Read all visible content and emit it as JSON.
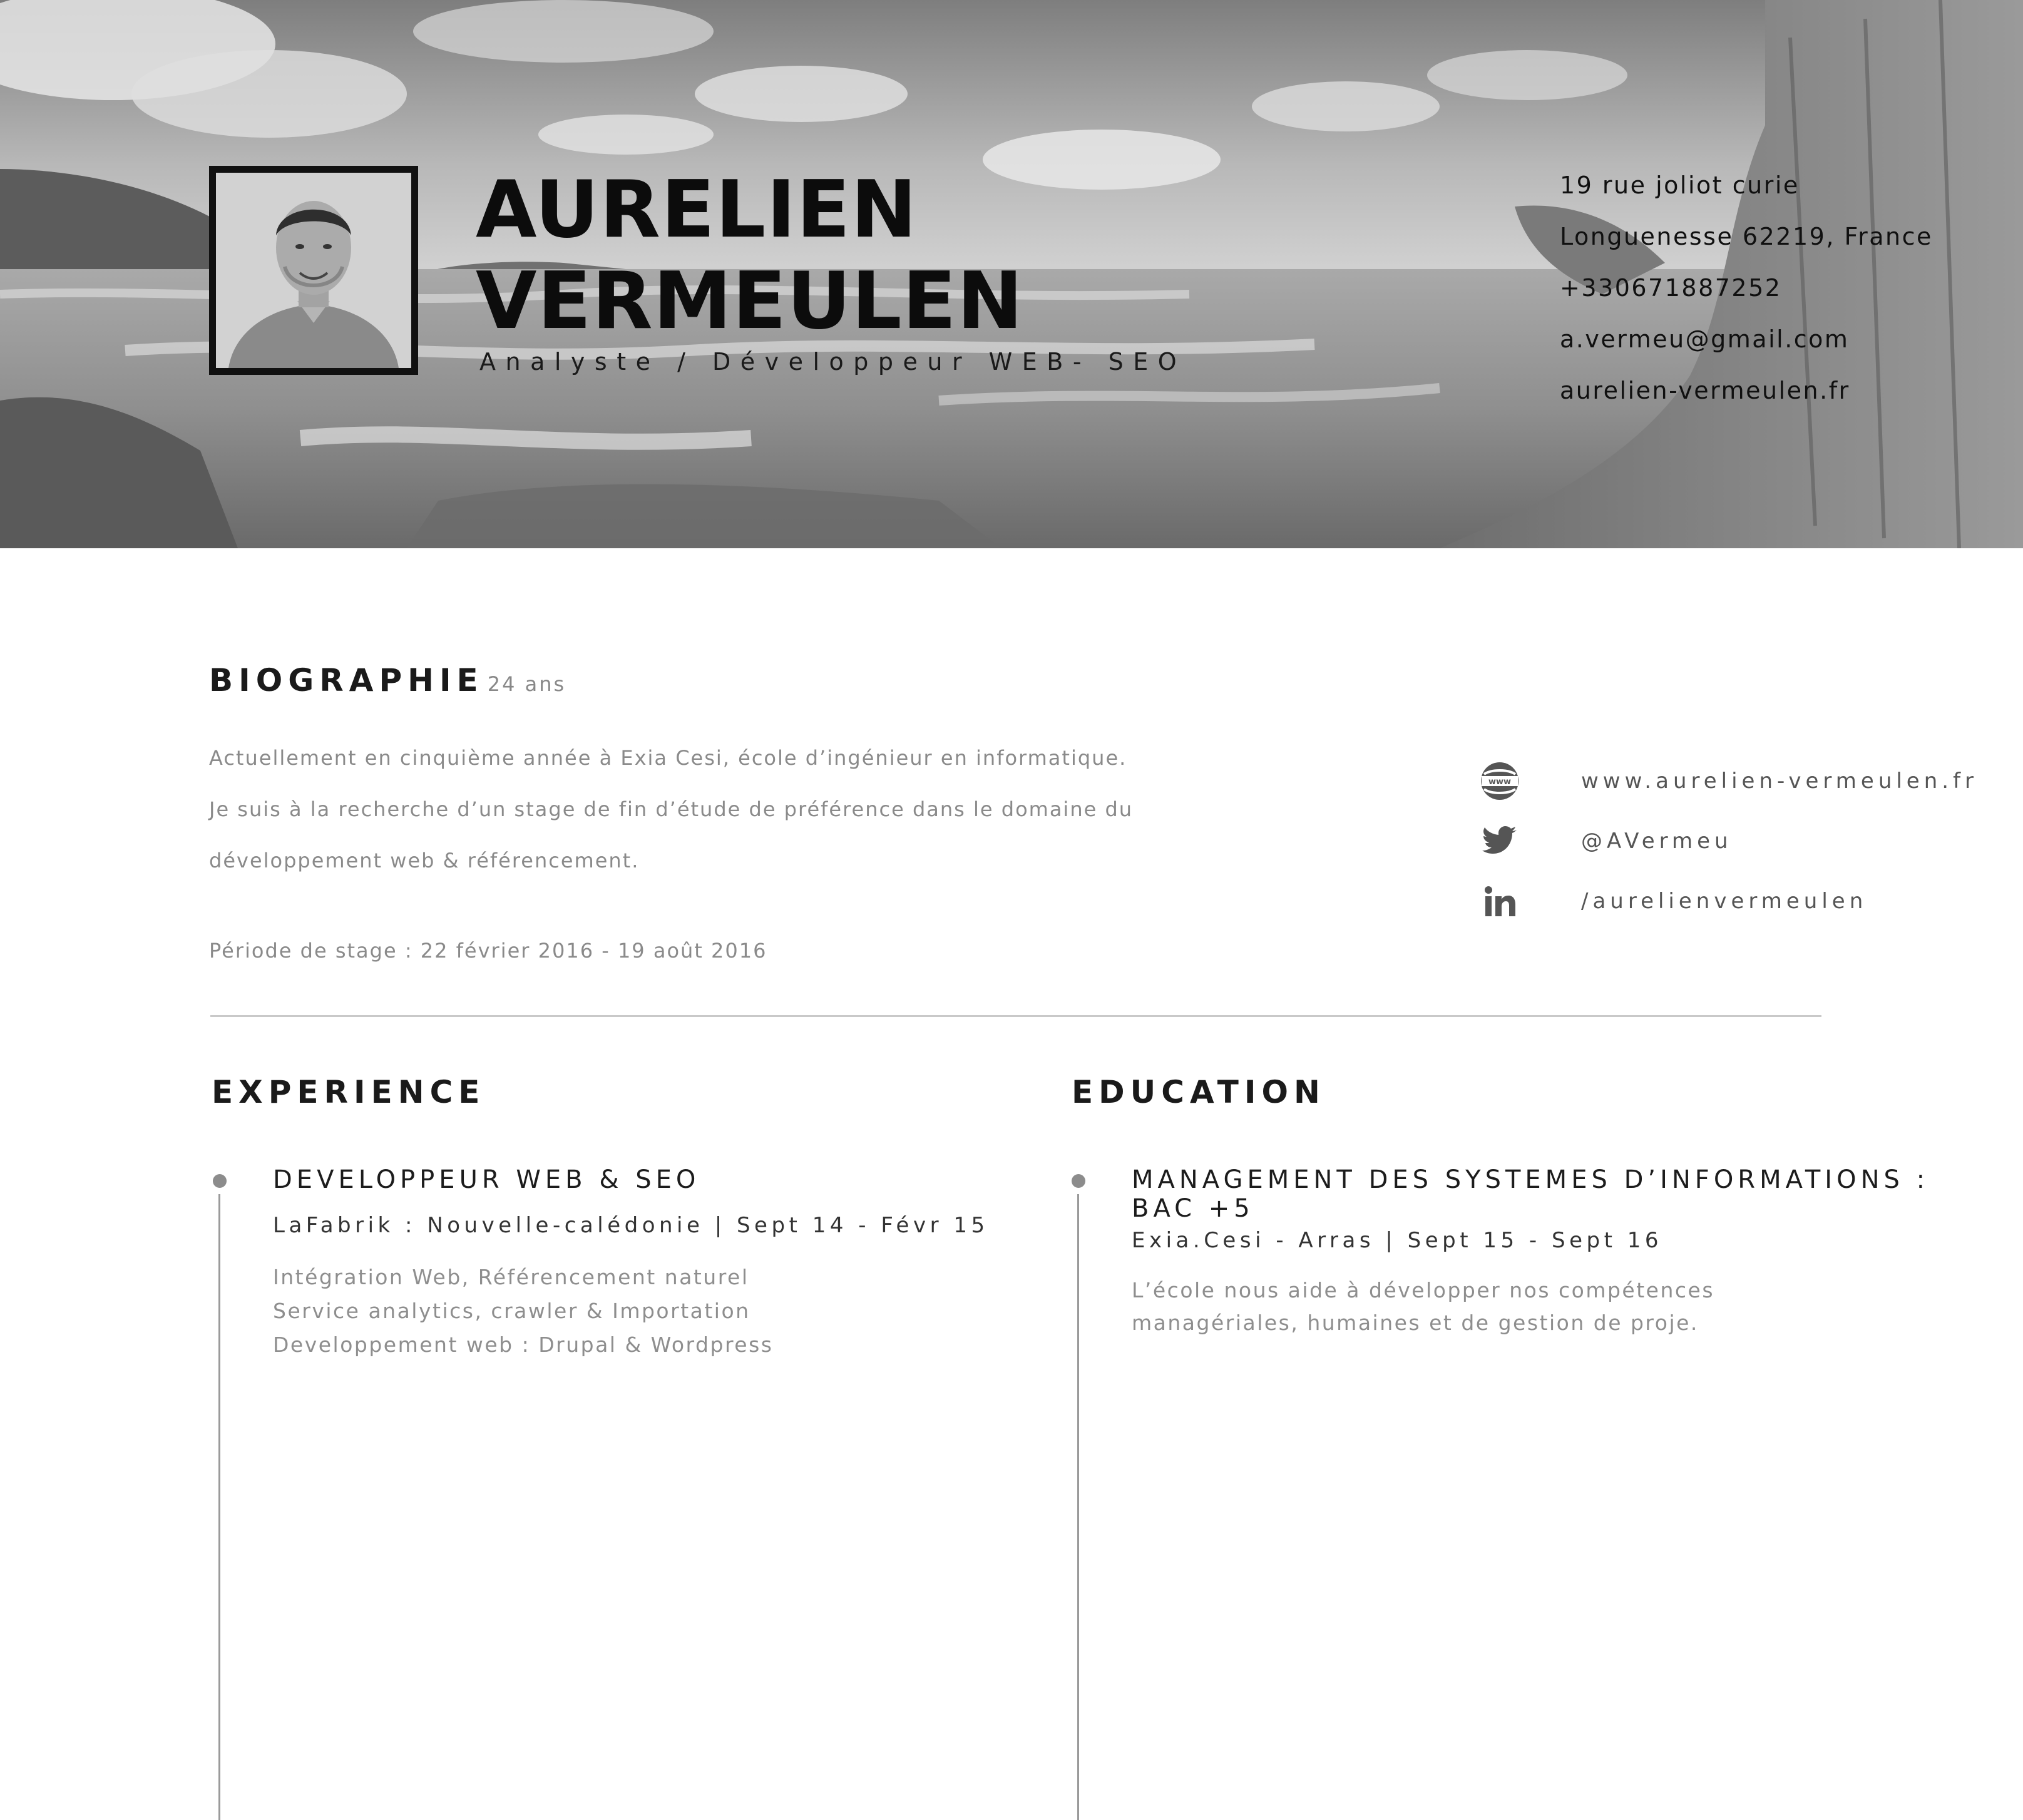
{
  "header": {
    "name_first": "AURELIEN",
    "name_last": "VERMEULEN",
    "job_title": "Analyste / Développeur WEB- SEO",
    "contact": [
      "19 rue joliot curie",
      "Longuenesse 62219, France",
      "+330671887252",
      "a.vermeu@gmail.com",
      "aurelien-vermeulen.fr"
    ]
  },
  "biography": {
    "title": "BIOGRAPHIE",
    "age": "24 ans",
    "lines": [
      "Actuellement en cinquième année à Exia Cesi, école d’ingénieur en informatique.",
      "Je suis à la recherche d’un stage de fin d’étude de préférence dans le domaine du",
      "développement web & référencement."
    ],
    "period": "Période de stage : 22 février 2016 - 19 août 2016"
  },
  "social": [
    {
      "icon": "www-globe-icon",
      "text": "www.aurelien-vermeulen.fr"
    },
    {
      "icon": "twitter-icon",
      "text": "@AVermeu"
    },
    {
      "icon": "linkedin-icon",
      "text": "/aurelienvermeulen"
    }
  ],
  "experience": {
    "title": "EXPERIENCE",
    "entry": {
      "title": "DEVELOPPEUR WEB & SEO",
      "subtitle": "LaFabrik : Nouvelle-calédonie | Sept 14 - Févr 15",
      "lines": [
        "Intégration Web, Référencement naturel",
        "Service analytics, crawler & Importation",
        "Developpement web : Drupal & Wordpress"
      ]
    }
  },
  "education": {
    "title": "EDUCATION",
    "entry": {
      "title_line1": "MANAGEMENT DES SYSTEMES D’INFORMATIONS :",
      "title_line2": "BAC +5",
      "subtitle": "Exia.Cesi - Arras | Sept 15 - Sept 16",
      "lines": [
        "L’école nous aide à développer nos compétences",
        "managériales, humaines et de gestion de proje."
      ]
    }
  },
  "colors": {
    "text_dark": "#111111",
    "text_muted": "#8a8a8a",
    "divider": "#c9c9c9"
  }
}
